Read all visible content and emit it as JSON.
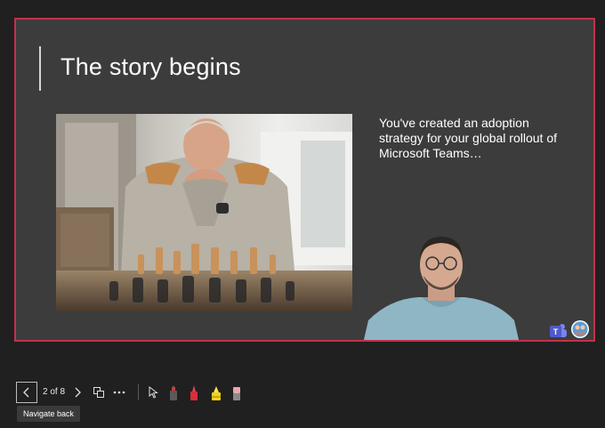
{
  "slide": {
    "title": "The story begins",
    "body_text": "You've created an adoption strategy for your global rollout of Microsoft Teams…",
    "photo_subject": "older man in sweater seated behind a chessboard",
    "presenter_video": "presenter webcam feed",
    "accent_color": "#c4314b"
  },
  "toolbar": {
    "slide_counter": "2 of 8",
    "back_tooltip": "Navigate back",
    "icons": [
      "chevron-left-icon",
      "chevron-right-icon",
      "slide-grid-icon",
      "more-icon",
      "laser-pointer-icon",
      "pen-icon",
      "highlighter-icon",
      "eraser-icon"
    ]
  },
  "status_icons": [
    "teams-logo",
    "user-avatar"
  ]
}
